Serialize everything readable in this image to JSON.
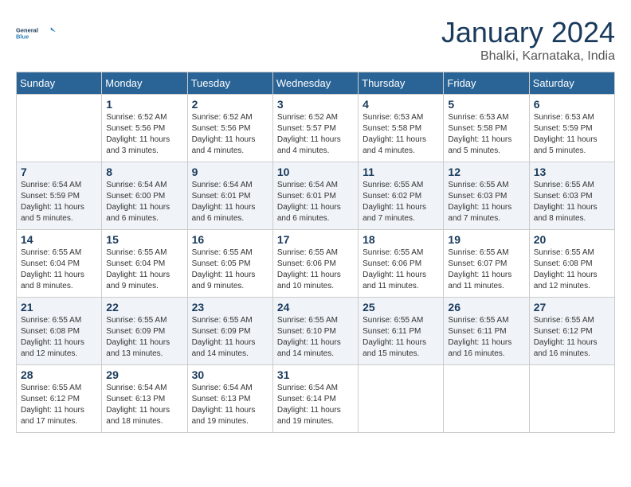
{
  "header": {
    "logo_line1": "General",
    "logo_line2": "Blue",
    "month": "January 2024",
    "location": "Bhalki, Karnataka, India"
  },
  "days_of_week": [
    "Sunday",
    "Monday",
    "Tuesday",
    "Wednesday",
    "Thursday",
    "Friday",
    "Saturday"
  ],
  "weeks": [
    [
      {
        "day": "",
        "info": ""
      },
      {
        "day": "1",
        "info": "Sunrise: 6:52 AM\nSunset: 5:56 PM\nDaylight: 11 hours\nand 3 minutes."
      },
      {
        "day": "2",
        "info": "Sunrise: 6:52 AM\nSunset: 5:56 PM\nDaylight: 11 hours\nand 4 minutes."
      },
      {
        "day": "3",
        "info": "Sunrise: 6:52 AM\nSunset: 5:57 PM\nDaylight: 11 hours\nand 4 minutes."
      },
      {
        "day": "4",
        "info": "Sunrise: 6:53 AM\nSunset: 5:58 PM\nDaylight: 11 hours\nand 4 minutes."
      },
      {
        "day": "5",
        "info": "Sunrise: 6:53 AM\nSunset: 5:58 PM\nDaylight: 11 hours\nand 5 minutes."
      },
      {
        "day": "6",
        "info": "Sunrise: 6:53 AM\nSunset: 5:59 PM\nDaylight: 11 hours\nand 5 minutes."
      }
    ],
    [
      {
        "day": "7",
        "info": "Sunrise: 6:54 AM\nSunset: 5:59 PM\nDaylight: 11 hours\nand 5 minutes."
      },
      {
        "day": "8",
        "info": "Sunrise: 6:54 AM\nSunset: 6:00 PM\nDaylight: 11 hours\nand 6 minutes."
      },
      {
        "day": "9",
        "info": "Sunrise: 6:54 AM\nSunset: 6:01 PM\nDaylight: 11 hours\nand 6 minutes."
      },
      {
        "day": "10",
        "info": "Sunrise: 6:54 AM\nSunset: 6:01 PM\nDaylight: 11 hours\nand 6 minutes."
      },
      {
        "day": "11",
        "info": "Sunrise: 6:55 AM\nSunset: 6:02 PM\nDaylight: 11 hours\nand 7 minutes."
      },
      {
        "day": "12",
        "info": "Sunrise: 6:55 AM\nSunset: 6:03 PM\nDaylight: 11 hours\nand 7 minutes."
      },
      {
        "day": "13",
        "info": "Sunrise: 6:55 AM\nSunset: 6:03 PM\nDaylight: 11 hours\nand 8 minutes."
      }
    ],
    [
      {
        "day": "14",
        "info": "Sunrise: 6:55 AM\nSunset: 6:04 PM\nDaylight: 11 hours\nand 8 minutes."
      },
      {
        "day": "15",
        "info": "Sunrise: 6:55 AM\nSunset: 6:04 PM\nDaylight: 11 hours\nand 9 minutes."
      },
      {
        "day": "16",
        "info": "Sunrise: 6:55 AM\nSunset: 6:05 PM\nDaylight: 11 hours\nand 9 minutes."
      },
      {
        "day": "17",
        "info": "Sunrise: 6:55 AM\nSunset: 6:06 PM\nDaylight: 11 hours\nand 10 minutes."
      },
      {
        "day": "18",
        "info": "Sunrise: 6:55 AM\nSunset: 6:06 PM\nDaylight: 11 hours\nand 11 minutes."
      },
      {
        "day": "19",
        "info": "Sunrise: 6:55 AM\nSunset: 6:07 PM\nDaylight: 11 hours\nand 11 minutes."
      },
      {
        "day": "20",
        "info": "Sunrise: 6:55 AM\nSunset: 6:08 PM\nDaylight: 11 hours\nand 12 minutes."
      }
    ],
    [
      {
        "day": "21",
        "info": "Sunrise: 6:55 AM\nSunset: 6:08 PM\nDaylight: 11 hours\nand 12 minutes."
      },
      {
        "day": "22",
        "info": "Sunrise: 6:55 AM\nSunset: 6:09 PM\nDaylight: 11 hours\nand 13 minutes."
      },
      {
        "day": "23",
        "info": "Sunrise: 6:55 AM\nSunset: 6:09 PM\nDaylight: 11 hours\nand 14 minutes."
      },
      {
        "day": "24",
        "info": "Sunrise: 6:55 AM\nSunset: 6:10 PM\nDaylight: 11 hours\nand 14 minutes."
      },
      {
        "day": "25",
        "info": "Sunrise: 6:55 AM\nSunset: 6:11 PM\nDaylight: 11 hours\nand 15 minutes."
      },
      {
        "day": "26",
        "info": "Sunrise: 6:55 AM\nSunset: 6:11 PM\nDaylight: 11 hours\nand 16 minutes."
      },
      {
        "day": "27",
        "info": "Sunrise: 6:55 AM\nSunset: 6:12 PM\nDaylight: 11 hours\nand 16 minutes."
      }
    ],
    [
      {
        "day": "28",
        "info": "Sunrise: 6:55 AM\nSunset: 6:12 PM\nDaylight: 11 hours\nand 17 minutes."
      },
      {
        "day": "29",
        "info": "Sunrise: 6:54 AM\nSunset: 6:13 PM\nDaylight: 11 hours\nand 18 minutes."
      },
      {
        "day": "30",
        "info": "Sunrise: 6:54 AM\nSunset: 6:13 PM\nDaylight: 11 hours\nand 19 minutes."
      },
      {
        "day": "31",
        "info": "Sunrise: 6:54 AM\nSunset: 6:14 PM\nDaylight: 11 hours\nand 19 minutes."
      },
      {
        "day": "",
        "info": ""
      },
      {
        "day": "",
        "info": ""
      },
      {
        "day": "",
        "info": ""
      }
    ]
  ]
}
